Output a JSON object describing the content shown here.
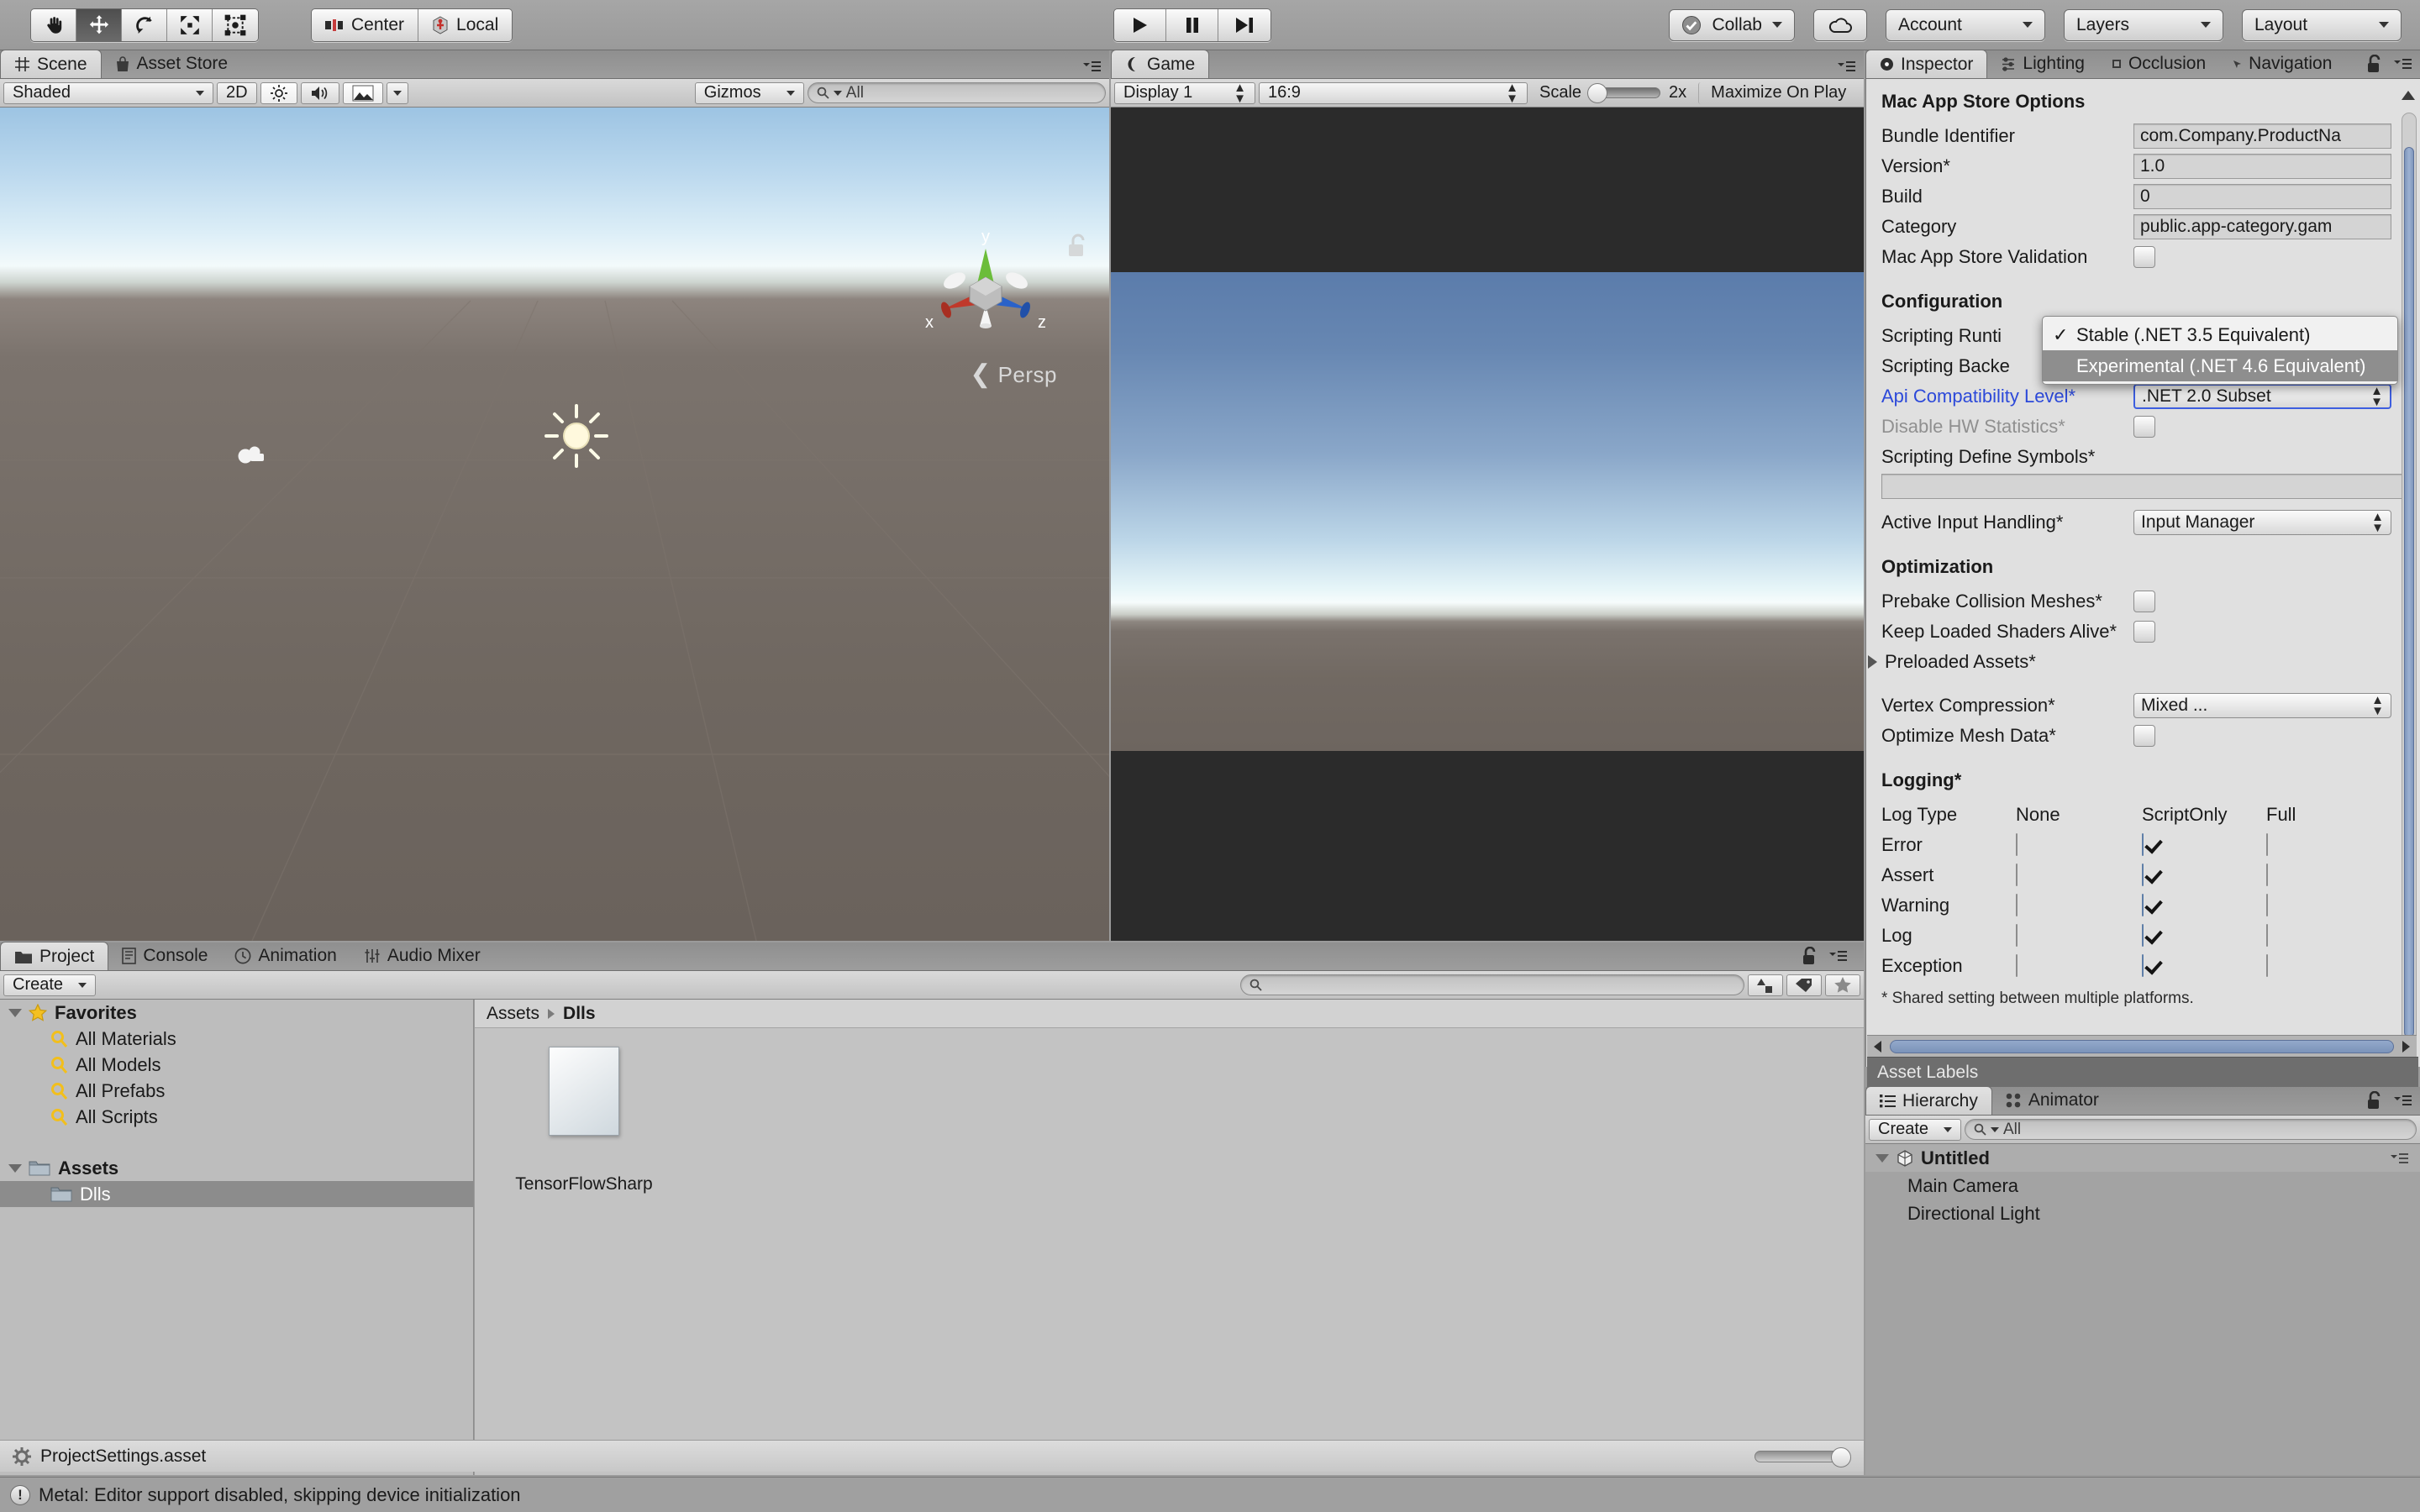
{
  "toolbar": {
    "transform_tools": [
      {
        "name": "hand-tool",
        "label": "",
        "active": false
      },
      {
        "name": "move-tool",
        "label": "",
        "active": true
      },
      {
        "name": "rotate-tool",
        "label": "",
        "active": false
      },
      {
        "name": "scale-tool",
        "label": "",
        "active": false
      },
      {
        "name": "rect-tool",
        "label": "",
        "active": false
      }
    ],
    "pivot_mode": "Center",
    "pivot_rotation": "Local",
    "play": "▶",
    "pause": "❙❙",
    "step": "▶|",
    "collab": "Collab",
    "cloud": "cloud-icon",
    "account": "Account",
    "layers": "Layers",
    "layout": "Layout"
  },
  "scene": {
    "tabs": [
      {
        "label": "Scene",
        "icon": "grid-icon",
        "selected": true
      },
      {
        "label": "Asset Store",
        "icon": "bag-icon",
        "selected": false
      }
    ],
    "draw_mode": "Shaded",
    "two_d": "2D",
    "lighting_icon": "sun-icon",
    "audio_icon": "speaker-icon",
    "fx_icon": "image-icon",
    "gizmos": "Gizmos",
    "search_placeholder": "All",
    "persp_label": "Persp",
    "axis_labels": {
      "x": "x",
      "y": "y",
      "z": "z"
    }
  },
  "game": {
    "tab": "Game",
    "display": "Display 1",
    "aspect": "16:9",
    "scale_label": "Scale",
    "scale_value": "2x",
    "maximize": "Maximize On Play"
  },
  "inspector": {
    "tabs": [
      {
        "label": "Inspector",
        "icon": "info-icon",
        "selected": true
      },
      {
        "label": "Lighting",
        "icon": "lighting-icon",
        "selected": false
      },
      {
        "label": "Occlusion",
        "icon": "occlusion-icon",
        "selected": false
      },
      {
        "label": "Navigation",
        "icon": "navigation-icon",
        "selected": false
      }
    ],
    "mac_section": "Mac App Store Options",
    "fields": [
      {
        "label": "Bundle Identifier",
        "value": "com.Company.ProductNa"
      },
      {
        "label": "Version*",
        "value": "1.0"
      },
      {
        "label": "Build",
        "value": "0"
      },
      {
        "label": "Category",
        "value": "public.app-category.gam"
      }
    ],
    "validation_label": "Mac App Store Validation",
    "validation_checked": false,
    "config_section": "Configuration",
    "scripting_runtime_label": "Scripting Runti",
    "scripting_backend_label": "Scripting Backe",
    "api_compat_label": "Api Compatibility Level*",
    "api_compat_value": ".NET 2.0 Subset",
    "disable_hw_label": "Disable HW Statistics*",
    "disable_hw_checked": false,
    "define_symbols_label": "Scripting Define Symbols*",
    "define_symbols_value": "",
    "active_input_label": "Active Input Handling*",
    "active_input_value": "Input Manager",
    "opt_section": "Optimization",
    "prebake_label": "Prebake Collision Meshes*",
    "prebake_checked": false,
    "keep_shaders_label": "Keep Loaded Shaders Alive*",
    "keep_shaders_checked": false,
    "preloaded_label": "Preloaded Assets*",
    "vertex_comp_label": "Vertex Compression*",
    "vertex_comp_value": "Mixed ...",
    "optimize_mesh_label": "Optimize Mesh Data*",
    "optimize_mesh_checked": false,
    "logging_section": "Logging*",
    "log_columns": [
      "Log Type",
      "None",
      "ScriptOnly",
      "Full"
    ],
    "log_rows": [
      {
        "type": "Error",
        "none": false,
        "scriptonly": true,
        "full": false
      },
      {
        "type": "Assert",
        "none": false,
        "scriptonly": true,
        "full": false
      },
      {
        "type": "Warning",
        "none": false,
        "scriptonly": true,
        "full": false
      },
      {
        "type": "Log",
        "none": false,
        "scriptonly": true,
        "full": false
      },
      {
        "type": "Exception",
        "none": false,
        "scriptonly": true,
        "full": false
      }
    ],
    "footnote": "* Shared setting between multiple platforms.",
    "asset_labels": "Asset Labels"
  },
  "dropdown": {
    "options": [
      {
        "label": "Stable (.NET 3.5 Equivalent)",
        "checked": true,
        "highlighted": false
      },
      {
        "label": "Experimental (.NET 4.6 Equivalent)",
        "checked": false,
        "highlighted": true
      }
    ],
    "check_glyph": "✓"
  },
  "hierarchy": {
    "tabs": [
      {
        "label": "Hierarchy",
        "icon": "list-icon",
        "selected": true
      },
      {
        "label": "Animator",
        "icon": "animator-icon",
        "selected": false
      }
    ],
    "create": "Create",
    "search_placeholder": "All",
    "scene_name": "Untitled",
    "objects": [
      "Main Camera",
      "Directional Light"
    ]
  },
  "project": {
    "tabs": [
      {
        "label": "Project",
        "icon": "folder-icon",
        "selected": true
      },
      {
        "label": "Console",
        "icon": "console-icon",
        "selected": false
      },
      {
        "label": "Animation",
        "icon": "clock-icon",
        "selected": false
      },
      {
        "label": "Audio Mixer",
        "icon": "mixer-icon",
        "selected": false
      }
    ],
    "create": "Create",
    "search_placeholder": "",
    "favorites": "Favorites",
    "favorite_items": [
      "All Materials",
      "All Models",
      "All Prefabs",
      "All Scripts"
    ],
    "assets_root": "Assets",
    "assets_children": [
      {
        "label": "Dlls",
        "selected": true
      }
    ],
    "breadcrumb": [
      "Assets",
      "Dlls"
    ],
    "asset_item": "TensorFlowSharp",
    "status_file": "ProjectSettings.asset"
  },
  "statusbar": {
    "message": "Metal: Editor support disabled, skipping device initialization"
  },
  "colors": {
    "accent_blue": "#2c49d9",
    "checkbox_blue": "#7ca3d2",
    "panel_bg": "#e0e0e0",
    "chrome": "#9b9b9b",
    "highlight": "#8e8e8e"
  }
}
